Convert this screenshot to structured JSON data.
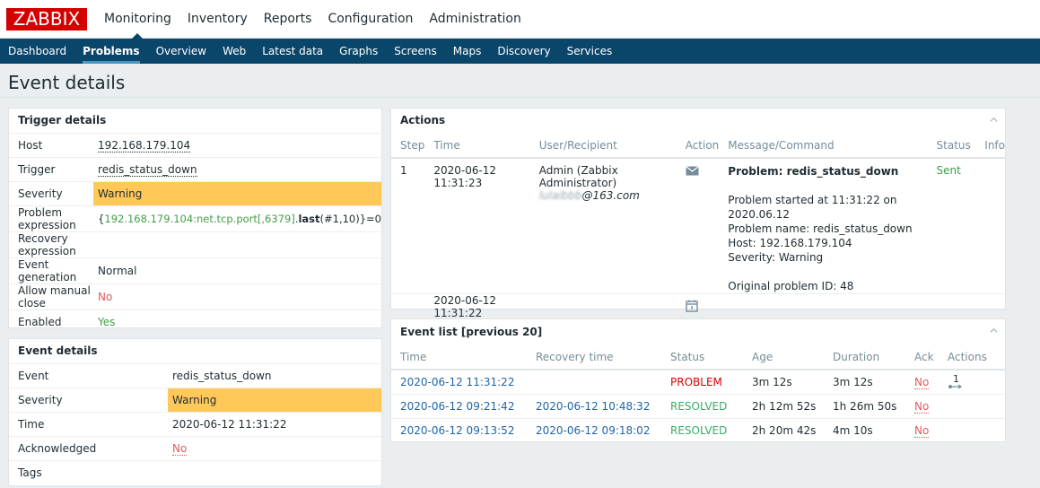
{
  "logo": "ZABBIX",
  "top_menu": [
    "Monitoring",
    "Inventory",
    "Reports",
    "Configuration",
    "Administration"
  ],
  "sub_menu": [
    "Dashboard",
    "Problems",
    "Overview",
    "Web",
    "Latest data",
    "Graphs",
    "Screens",
    "Maps",
    "Discovery",
    "Services"
  ],
  "page_title": "Event details",
  "trigger_details": {
    "title": "Trigger details",
    "host_label": "Host",
    "host": "192.168.179.104",
    "trigger_label": "Trigger",
    "trigger": "redis_status_down",
    "severity_label": "Severity",
    "severity": "Warning",
    "problem_expr_label": "Problem expression",
    "expr_open": "{",
    "expr_item": "192.168.179.104:net.tcp.port[,6379]",
    "expr_dot": ".",
    "expr_func": "last",
    "expr_args": "(#1,10)}=0",
    "recovery_expr_label": "Recovery expression",
    "event_gen_label": "Event generation",
    "event_gen": "Normal",
    "manual_close_label": "Allow manual close",
    "manual_close": "No",
    "enabled_label": "Enabled",
    "enabled": "Yes"
  },
  "event_details": {
    "title": "Event details",
    "event_label": "Event",
    "event": "redis_status_down",
    "severity_label": "Severity",
    "severity": "Warning",
    "time_label": "Time",
    "time": "2020-06-12 11:31:22",
    "ack_label": "Acknowledged",
    "ack": "No",
    "tags_label": "Tags"
  },
  "actions": {
    "title": "Actions",
    "headers": [
      "Step",
      "Time",
      "User/Recipient",
      "Action",
      "Message/Command",
      "Status",
      "Info"
    ],
    "row1": {
      "step": "1",
      "time": "2020-06-12 11:31:23",
      "user": "Admin (Zabbix Administrator)",
      "recipient_blurred": "lulaibbb",
      "recipient_domain": "@163.com",
      "msg_title": "Problem: redis_status_down",
      "msg_lines": [
        "Problem started at 11:31:22 on 2020.06.12",
        "Problem name: redis_status_down",
        "Host: 192.168.179.104",
        "Severity: Warning",
        "Original problem ID: 48"
      ],
      "status": "Sent"
    },
    "row2": {
      "time": "2020-06-12 11:31:22"
    }
  },
  "event_list": {
    "title": "Event list [previous 20]",
    "headers": [
      "Time",
      "Recovery time",
      "Status",
      "Age",
      "Duration",
      "Ack",
      "Actions"
    ],
    "rows": [
      {
        "time": "2020-06-12 11:31:22",
        "recovery": "",
        "status": "PROBLEM",
        "age": "3m 12s",
        "duration": "3m 12s",
        "ack": "No",
        "actions": "1"
      },
      {
        "time": "2020-06-12 09:21:42",
        "recovery": "2020-06-12 10:48:32",
        "status": "RESOLVED",
        "age": "2h 12m 52s",
        "duration": "1h 26m 50s",
        "ack": "No",
        "actions": ""
      },
      {
        "time": "2020-06-12 09:13:52",
        "recovery": "2020-06-12 09:18:02",
        "status": "RESOLVED",
        "age": "2h 20m 42s",
        "duration": "4m 10s",
        "ack": "No",
        "actions": ""
      }
    ]
  },
  "colors": {
    "brand": "#d40000",
    "nav": "#0a466a",
    "warning": "#ffc859",
    "problem": "#e45959",
    "resolved": "#429e47",
    "link": "#1f65a6"
  }
}
